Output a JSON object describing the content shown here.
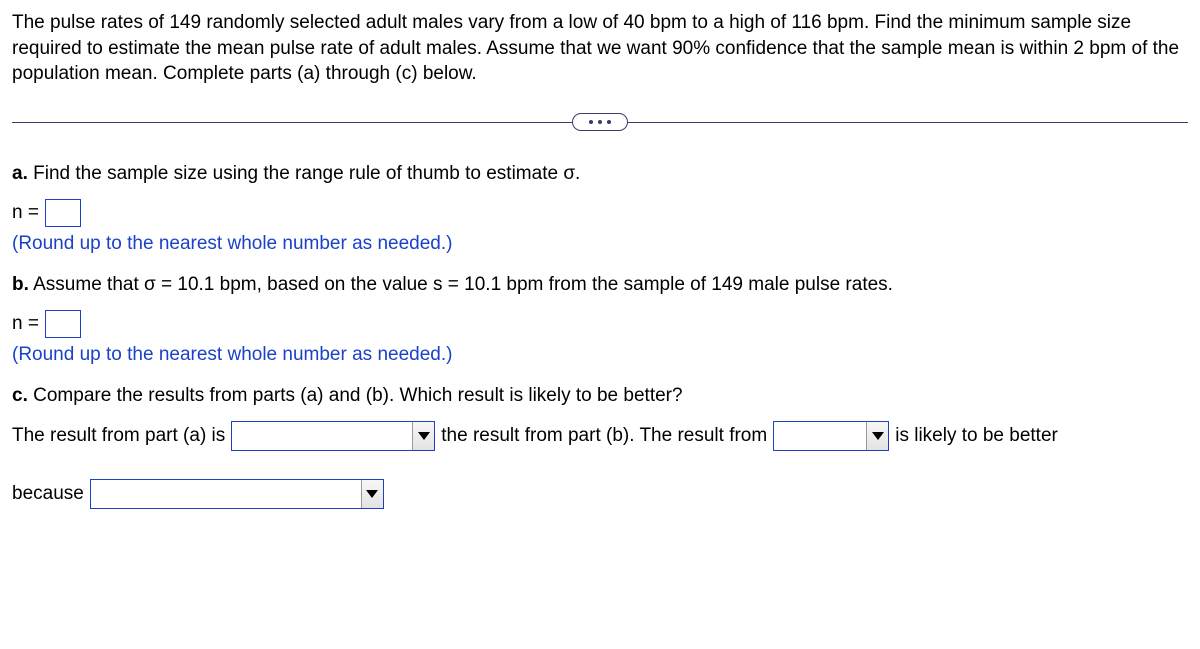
{
  "intro": "The pulse rates of 149 randomly selected adult males vary from a low of 40 bpm to a high of 116 bpm. Find the minimum sample size required to estimate the mean pulse rate of adult males. Assume that we want 90% confidence that the sample mean is within 2 bpm of the population mean. Complete parts (a) through (c) below.",
  "partA": {
    "label": "a.",
    "text": "Find the sample size using the range rule of thumb to estimate σ.",
    "nEquals": "n =",
    "hint": "(Round up to the nearest whole number as needed.)"
  },
  "partB": {
    "label": "b.",
    "text": "Assume that σ = 10.1 bpm, based on the value s = 10.1 bpm from the sample of 149 male pulse rates.",
    "nEquals": "n =",
    "hint": "(Round up to the nearest whole number as needed.)"
  },
  "partC": {
    "label": "c.",
    "text": "Compare the results from parts (a) and (b). Which result is likely to be better?",
    "seg1": "The result from part (a) is",
    "seg2": "the result from part (b). The result from",
    "seg3": "is likely to be better",
    "seg4": "because"
  }
}
